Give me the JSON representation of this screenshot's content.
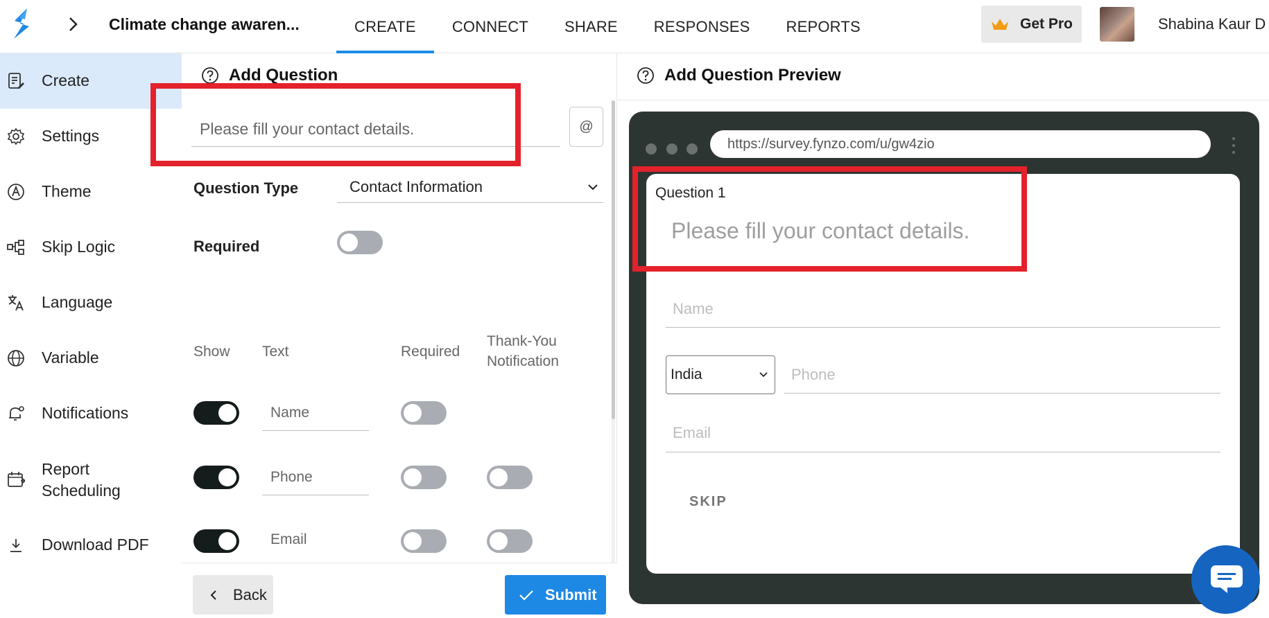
{
  "header": {
    "survey_title": "Climate change awaren...",
    "tabs": [
      {
        "label": "CREATE",
        "active": true
      },
      {
        "label": "CONNECT",
        "active": false
      },
      {
        "label": "SHARE",
        "active": false
      },
      {
        "label": "RESPONSES",
        "active": false
      },
      {
        "label": "REPORTS",
        "active": false
      }
    ],
    "get_pro_label": "Get Pro",
    "user_name": "Shabina Kaur D"
  },
  "sidebar": {
    "items": [
      {
        "label": "Create",
        "icon": "form-edit-icon",
        "active": true
      },
      {
        "label": "Settings",
        "icon": "gear-icon"
      },
      {
        "label": "Theme",
        "icon": "theme-icon"
      },
      {
        "label": "Skip Logic",
        "icon": "skip-logic-icon"
      },
      {
        "label": "Language",
        "icon": "translate-icon"
      },
      {
        "label": "Variable",
        "icon": "globe-icon"
      },
      {
        "label": "Notifications",
        "icon": "bell-icon"
      },
      {
        "label": "Report Scheduling",
        "icon": "calendar-icon"
      },
      {
        "label": "Download PDF",
        "icon": "download-icon"
      }
    ]
  },
  "editor": {
    "heading": "Add Question",
    "question_placeholder": "Please fill your contact details.",
    "at_button": "@",
    "question_type_label": "Question Type",
    "question_type_value": "Contact Information",
    "required_label": "Required",
    "required_on": false,
    "columns": {
      "show": "Show",
      "text": "Text",
      "required": "Required",
      "thankyou": "Thank-You Notification"
    },
    "fields": [
      {
        "text": "Name",
        "show": true,
        "required": false,
        "notify": null
      },
      {
        "text": "Phone",
        "show": true,
        "required": false,
        "notify": false
      },
      {
        "text": "Email",
        "show": true,
        "required": false,
        "notify": false
      }
    ],
    "back_label": "Back",
    "submit_label": "Submit"
  },
  "preview": {
    "heading": "Add Question Preview",
    "url": "https://survey.fynzo.com/u/gw4zio",
    "question_number": "Question 1",
    "question_text": "Please fill your contact details.",
    "name_placeholder": "Name",
    "country": "India",
    "phone_placeholder": "Phone",
    "email_placeholder": "Email",
    "skip_label": "SKIP"
  },
  "colors": {
    "accent": "#1d8ce8",
    "highlight": "#e3222b",
    "browser_frame": "#2d3532",
    "toggle_on": "#151c1c",
    "toggle_off": "#a9adb3",
    "sidebar_active": "#dbeafb"
  }
}
